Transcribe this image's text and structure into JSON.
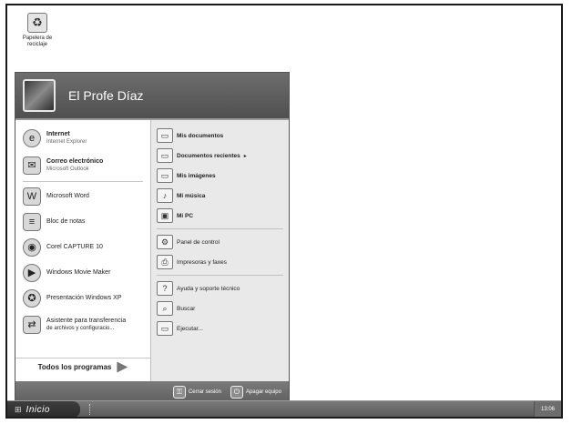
{
  "desktop": {
    "recycle_bin": {
      "label": "Papelera de reciclaje",
      "icon": "recycle-bin-icon"
    }
  },
  "start_menu": {
    "user_name": "El Profe Díaz",
    "left_items": [
      {
        "title": "Internet",
        "subtitle": "Internet Explorer",
        "icon": "internet-explorer-icon"
      },
      {
        "title": "Correo electrónico",
        "subtitle": "Microsoft Outlook",
        "icon": "outlook-icon"
      },
      {
        "title": "Microsoft Word",
        "icon": "word-icon"
      },
      {
        "title": "Bloc de notas",
        "icon": "notepad-icon"
      },
      {
        "title": "Corel CAPTURE 10",
        "icon": "corel-capture-icon"
      },
      {
        "title": "Windows Movie Maker",
        "icon": "movie-maker-icon"
      },
      {
        "title": "Presentación Windows XP",
        "icon": "windows-tour-icon"
      },
      {
        "title": "Asistente para transferencia",
        "subtitle": "de archivos y configuracio...",
        "icon": "transfer-wizard-icon"
      }
    ],
    "all_programs": "Todos los programas",
    "right_items": [
      {
        "label": "Mis documentos",
        "icon": "documents-folder-icon"
      },
      {
        "label": "Documentos recientes",
        "icon": "recent-documents-icon",
        "has_submenu": true
      },
      {
        "label": "Mis imágenes",
        "icon": "pictures-folder-icon"
      },
      {
        "label": "Mi música",
        "icon": "music-folder-icon"
      },
      {
        "label": "Mi PC",
        "icon": "my-computer-icon"
      },
      {
        "label": "Panel de control",
        "icon": "control-panel-icon"
      },
      {
        "label": "Impresoras y faxes",
        "icon": "printer-icon"
      },
      {
        "label": "Ayuda y soporte técnico",
        "icon": "help-icon"
      },
      {
        "label": "Buscar",
        "icon": "search-icon"
      },
      {
        "label": "Ejecutar...",
        "icon": "run-icon"
      }
    ],
    "footer": {
      "logoff": "Cerrar sesión",
      "shutdown": "Apagar equipo"
    }
  },
  "taskbar": {
    "start_label": "Inicio",
    "clock": "13:06"
  }
}
